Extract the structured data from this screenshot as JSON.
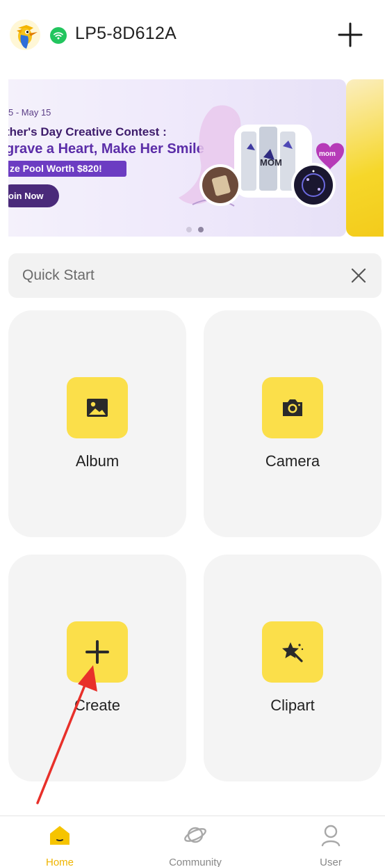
{
  "header": {
    "device_name": "LP5-8D612A",
    "logo_icon": "bird-logo-icon",
    "wifi_icon": "wifi-connected-icon",
    "add_icon": "plus-icon"
  },
  "banner": {
    "date": "5 - May 15",
    "title_line1": "ther's Day Creative Contest :",
    "title_line2": "grave a Heart, Make Her Smile",
    "prize": "ze Pool Worth $820!",
    "cta": "oin Now",
    "badge": "mom",
    "page_count": 2,
    "active_page": 2
  },
  "quick_start": {
    "label": "Quick Start",
    "close_icon": "close-icon"
  },
  "cards": [
    {
      "label": "Album",
      "icon": "image-icon"
    },
    {
      "label": "Camera",
      "icon": "camera-icon"
    },
    {
      "label": "Create",
      "icon": "plus-icon"
    },
    {
      "label": "Clipart",
      "icon": "star-wand-icon"
    }
  ],
  "bottom_nav": [
    {
      "label": "Home",
      "icon": "home-icon",
      "active": true
    },
    {
      "label": "Community",
      "icon": "planet-icon",
      "active": false
    },
    {
      "label": "User",
      "icon": "user-icon",
      "active": false
    }
  ],
  "colors": {
    "accent": "#fbdf4a",
    "active_nav": "#efb400",
    "wifi_green": "#22c55e",
    "annotation_arrow": "#e8302a"
  }
}
